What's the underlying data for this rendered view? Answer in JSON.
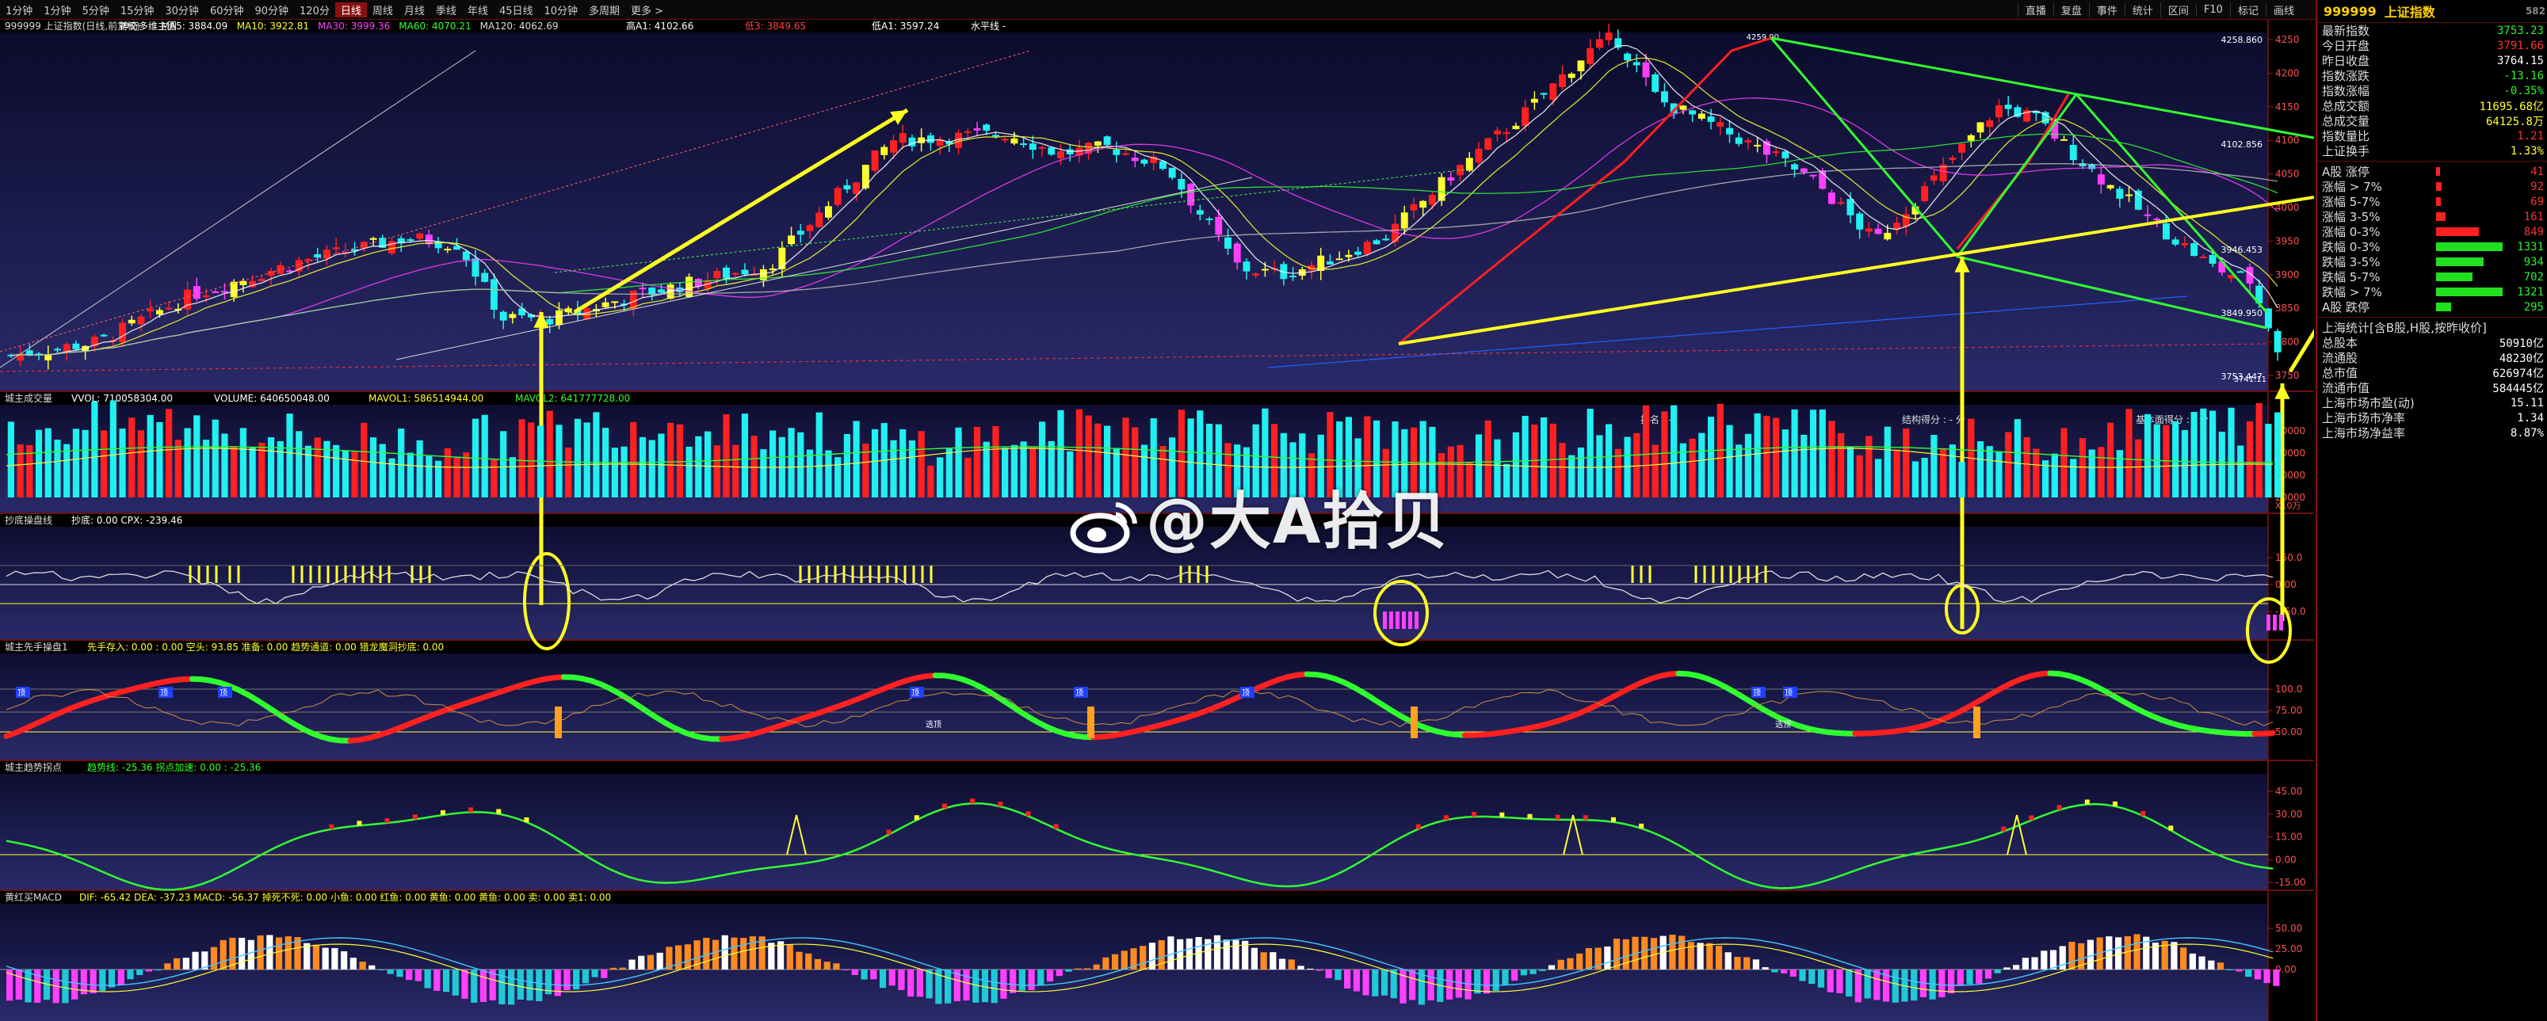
{
  "topbar": {
    "left_items": [
      "1分钟",
      "1分钟",
      "5分钟",
      "15分钟",
      "30分钟",
      "60分钟",
      "90分钟",
      "120分",
      "日线",
      "周线",
      "月线",
      "季线",
      "年线",
      "45日线",
      "10分钟",
      "多周期",
      "更多 >"
    ],
    "active_index": 8,
    "right_items": [
      "直播",
      "复盘",
      "事件",
      "统计",
      "区间",
      "F10",
      "标记",
      "画线"
    ]
  },
  "panels": {
    "main": {
      "title": "999999 上证指数(日线,前复权)",
      "indicator_name": "神奇多维主图",
      "ma5": "MA5: 3884.09",
      "ma10": "MA10: 3922.81",
      "ma30": "MA30: 3999.36",
      "ma60": "MA60: 4070.21",
      "ma120": "MA120: 4062.69",
      "info": "高A1: 4102.66",
      "info2": "低3: 3849.65",
      "info3": "低A1: 3597.24",
      "info4": "水平线 -",
      "ticks": [
        "4250",
        "4200",
        "4150",
        "4100",
        "4050",
        "4000",
        "3950",
        "3900",
        "3850",
        "3800",
        "3750"
      ],
      "high_label": "4258.860",
      "mid_label": "4102.856",
      "low_label1": "3946.453",
      "low_label2": "3849.950",
      "low_label3": "3753.447",
      "peak_text": "4259.90",
      "low_text": "3741.11"
    },
    "volume": {
      "title": "城主成交量",
      "vvol": "VVOL: 710058304.00",
      "volume": "VOLUME: 640650048.00",
      "mavol1": "MAVOL1: 586514944.00",
      "mavol2": "MAVOL2: 641777728.00",
      "ticks": [
        "80000",
        "60000",
        "40000",
        "20000"
      ],
      "unit": "X10万",
      "rank_label": "排名 : -",
      "struct_label": "结构得分 : - 分",
      "basic_label": "基本面得分 : - 分"
    },
    "bottom_finder": {
      "title": "抄底操盘线",
      "vals": "抄底: 0.00  CPX: -239.46",
      "ticks": [
        "150.0",
        "0.00",
        "-150.0"
      ]
    },
    "trader": {
      "title": "城主先手操盘1",
      "vals": "先手存入: 0.00   : 0.00  空头: 93.85  准备: 0.00  趋势通道: 0.00  猎龙魔洞抄底: 0.00",
      "ticks": [
        "100.0",
        "75.00",
        "50.00"
      ],
      "top_label": "顶",
      "select_label": "选顶"
    },
    "trend": {
      "title": "城主趋势拐点",
      "vals": "趋势线: -25.36  拐点加速: 0.00   : -25.36",
      "ticks": [
        "45.00",
        "30.00",
        "15.00",
        "0.00",
        "-15.00"
      ]
    },
    "macd": {
      "title": "黄红买MACD",
      "vals": "DIF: -65.42  DEA: -37.23  MACD: -56.37  掉死不死: 0.00  小鱼: 0.00  红鱼: 0.00  黄鱼: 0.00  黄鱼: 0.00  卖: 0.00  卖1: 0.00",
      "ticks": [
        "50.00",
        "25.00",
        "0.00"
      ]
    }
  },
  "sidepanel": {
    "code": "999999",
    "name": "上证指数",
    "corner": "582",
    "rows": [
      {
        "label": "最新指数",
        "value": "3753.23",
        "color": "green"
      },
      {
        "label": "今日开盘",
        "value": "3791.66",
        "color": "red"
      },
      {
        "label": "昨日收盘",
        "value": "3764.15",
        "color": "white"
      },
      {
        "label": "指数涨跌",
        "value": "-13.16",
        "color": "green"
      },
      {
        "label": "指数涨幅",
        "value": "-0.35%",
        "color": "green"
      },
      {
        "label": "总成交额",
        "value": "11695.68亿",
        "color": "yellow"
      },
      {
        "label": "总成交量",
        "value": "64125.8万",
        "color": "yellow"
      },
      {
        "label": "指数量比",
        "value": "1.21",
        "color": "red"
      },
      {
        "label": "上证换手",
        "value": "1.33%",
        "color": "yellow"
      }
    ],
    "dist": [
      {
        "label": "A股 涨停",
        "value": "41",
        "color": "red",
        "width": 4
      },
      {
        "label": "涨幅 > 7%",
        "value": "92",
        "color": "red",
        "width": 6
      },
      {
        "label": "涨幅 5-7%",
        "value": "69",
        "color": "red",
        "width": 5
      },
      {
        "label": "涨幅 3-5%",
        "value": "161",
        "color": "red",
        "width": 10
      },
      {
        "label": "涨幅 0-3%",
        "value": "849",
        "color": "red",
        "width": 45
      },
      {
        "label": "跌幅 0-3%",
        "value": "1331",
        "color": "green",
        "width": 70
      },
      {
        "label": "跌幅 3-5%",
        "value": "934",
        "color": "green",
        "width": 50
      },
      {
        "label": "跌幅 5-7%",
        "value": "702",
        "color": "green",
        "width": 38
      },
      {
        "label": "跌幅 > 7%",
        "value": "1321",
        "color": "green",
        "width": 70
      },
      {
        "label": "A股 跌停",
        "value": "295",
        "color": "green",
        "width": 16
      }
    ],
    "stats_title": "上海统计[含B股,H股,按昨收价]",
    "stats": [
      {
        "label": "总股本",
        "value": "50910亿"
      },
      {
        "label": "流通股",
        "value": "48230亿"
      },
      {
        "label": "总市值",
        "value": "626974亿"
      },
      {
        "label": "流通市值",
        "value": "584445亿"
      },
      {
        "label": "上海市场市盈(动)",
        "value": "15.11"
      },
      {
        "label": "上海市场市净率",
        "value": "1.34"
      },
      {
        "label": "上海市场净益率",
        "value": "8.87%"
      }
    ]
  },
  "watermark": "@大A拾贝",
  "colors": {
    "up": "#ff2020",
    "down": "#20f0f0",
    "yellow": "#ffff20",
    "green": "#30ff30",
    "magenta": "#ff40ff"
  }
}
